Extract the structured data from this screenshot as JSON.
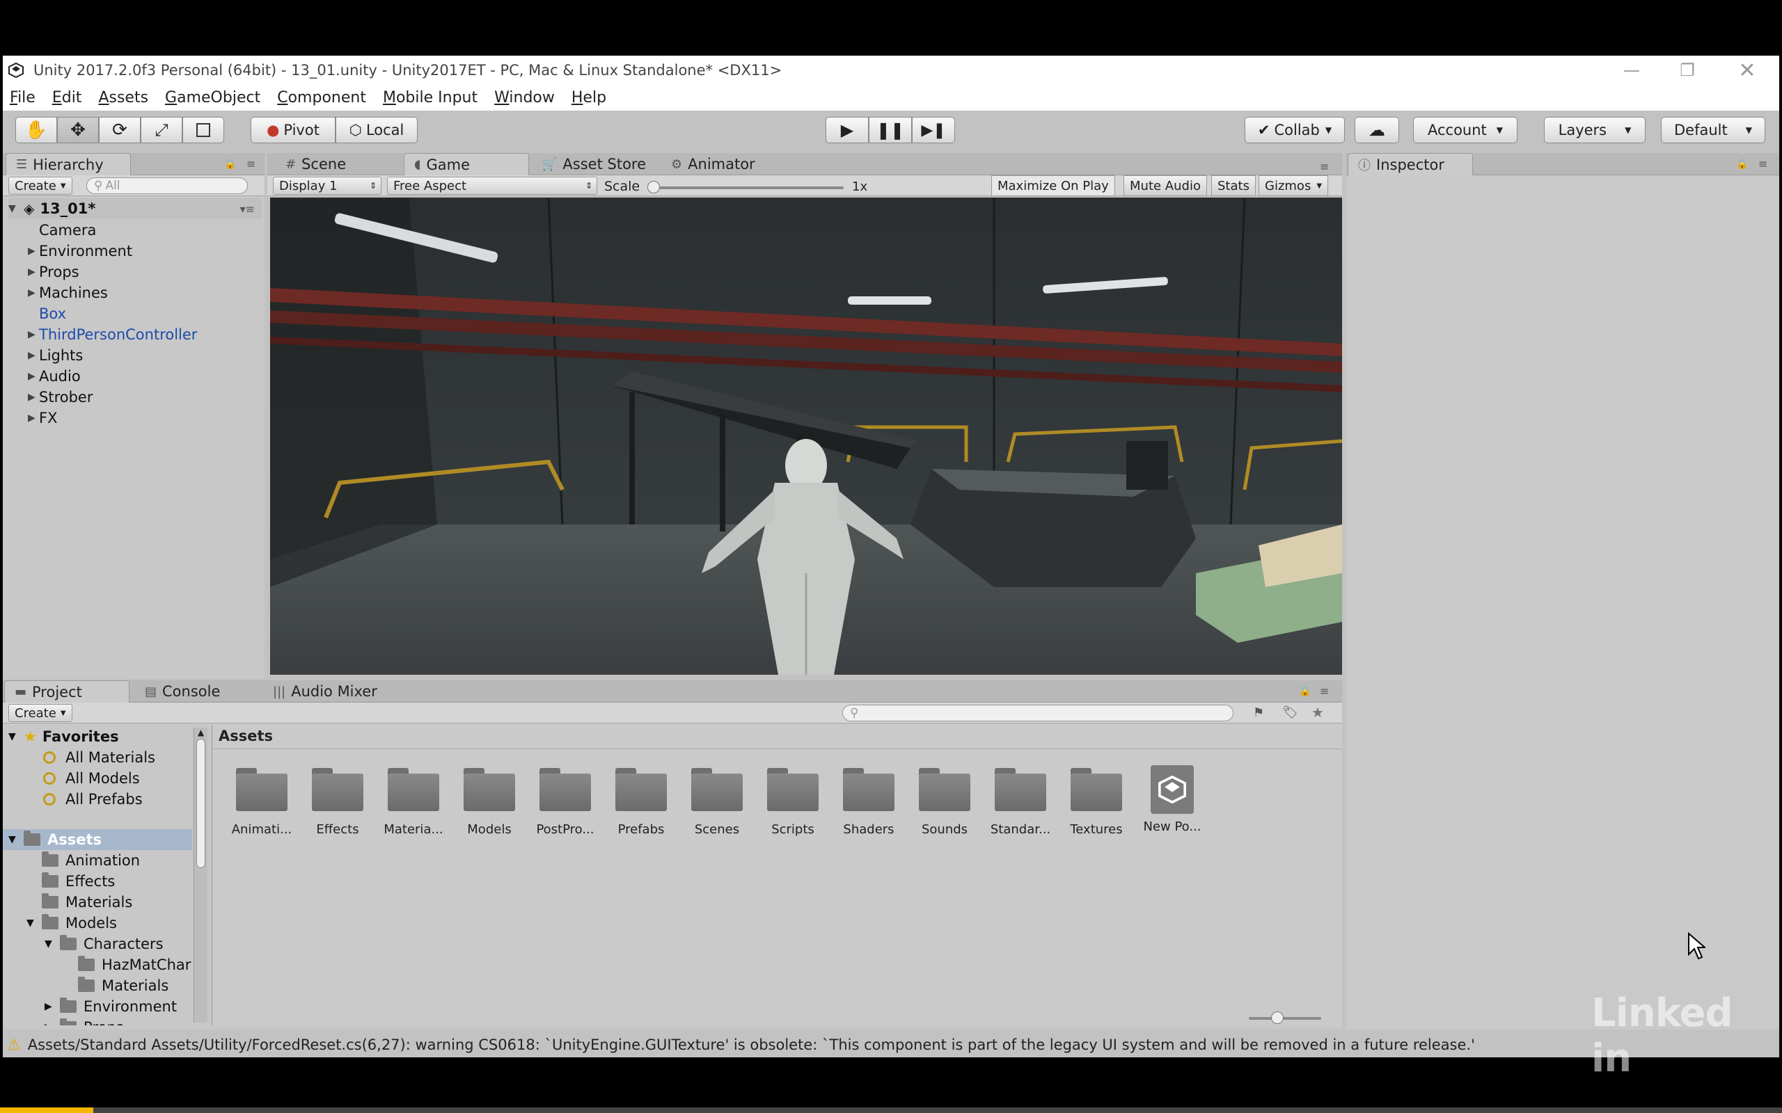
{
  "window": {
    "title": "Unity 2017.2.0f3 Personal (64bit) - 13_01.unity - Unity2017ET - PC, Mac & Linux Standalone* <DX11>"
  },
  "menu": [
    "File",
    "Edit",
    "Assets",
    "GameObject",
    "Component",
    "Mobile Input",
    "Window",
    "Help"
  ],
  "toolbar": {
    "pivot": "Pivot",
    "local": "Local",
    "collab": "Collab",
    "account": "Account",
    "layers": "Layers",
    "layout": "Default"
  },
  "hierarchy": {
    "tab": "Hierarchy",
    "create": "Create",
    "search_placeholder": "All",
    "scene": "13_01*",
    "items": [
      {
        "label": "Camera",
        "expandable": false,
        "prefab": false
      },
      {
        "label": "Environment",
        "expandable": true,
        "prefab": false
      },
      {
        "label": "Props",
        "expandable": true,
        "prefab": false
      },
      {
        "label": "Machines",
        "expandable": true,
        "prefab": false
      },
      {
        "label": "Box",
        "expandable": false,
        "prefab": true
      },
      {
        "label": "ThirdPersonController",
        "expandable": true,
        "prefab": true
      },
      {
        "label": "Lights",
        "expandable": true,
        "prefab": false
      },
      {
        "label": "Audio",
        "expandable": true,
        "prefab": false
      },
      {
        "label": "Strober",
        "expandable": true,
        "prefab": false
      },
      {
        "label": "FX",
        "expandable": true,
        "prefab": false
      }
    ]
  },
  "center_tabs": [
    "Scene",
    "Game",
    "Asset Store",
    "Animator"
  ],
  "game_bar": {
    "display": "Display 1",
    "aspect": "Free Aspect",
    "scale_label": "Scale",
    "scale_value": "1x",
    "maximize": "Maximize On Play",
    "mute": "Mute Audio",
    "stats": "Stats",
    "gizmos": "Gizmos"
  },
  "inspector": {
    "tab": "Inspector"
  },
  "bottom_tabs": [
    "Project",
    "Console",
    "Audio Mixer"
  ],
  "project": {
    "create": "Create",
    "favorites_label": "Favorites",
    "favorites": [
      "All Materials",
      "All Models",
      "All Prefabs"
    ],
    "assets_label": "Assets",
    "tree": [
      {
        "label": "Animation",
        "depth": 1,
        "arrow": ""
      },
      {
        "label": "Effects",
        "depth": 1,
        "arrow": ""
      },
      {
        "label": "Materials",
        "depth": 1,
        "arrow": ""
      },
      {
        "label": "Models",
        "depth": 1,
        "arrow": "down"
      },
      {
        "label": "Characters",
        "depth": 2,
        "arrow": "down"
      },
      {
        "label": "HazMatChar",
        "depth": 3,
        "arrow": ""
      },
      {
        "label": "Materials",
        "depth": 3,
        "arrow": ""
      },
      {
        "label": "Environment",
        "depth": 2,
        "arrow": "right"
      },
      {
        "label": "Props",
        "depth": 2,
        "arrow": "right"
      }
    ],
    "breadcrumb": "Assets",
    "grid": [
      "Animati...",
      "Effects",
      "Materia...",
      "Models",
      "PostPro...",
      "Prefabs",
      "Scenes",
      "Scripts",
      "Shaders",
      "Sounds",
      "Standar...",
      "Textures",
      "New Po..."
    ]
  },
  "status": {
    "message": "Assets/Standard Assets/Utility/ForcedReset.cs(6,27): warning CS0618: `UnityEngine.GUITexture' is obsolete: `This component is part of the legacy UI system and will be removed in a future release.'"
  },
  "watermark": "Linked in",
  "colors": {
    "accent": "#3e8ee6",
    "prefab_blue": "#1d4aa8",
    "warning": "#e0a800",
    "progress": "#f5b700"
  }
}
